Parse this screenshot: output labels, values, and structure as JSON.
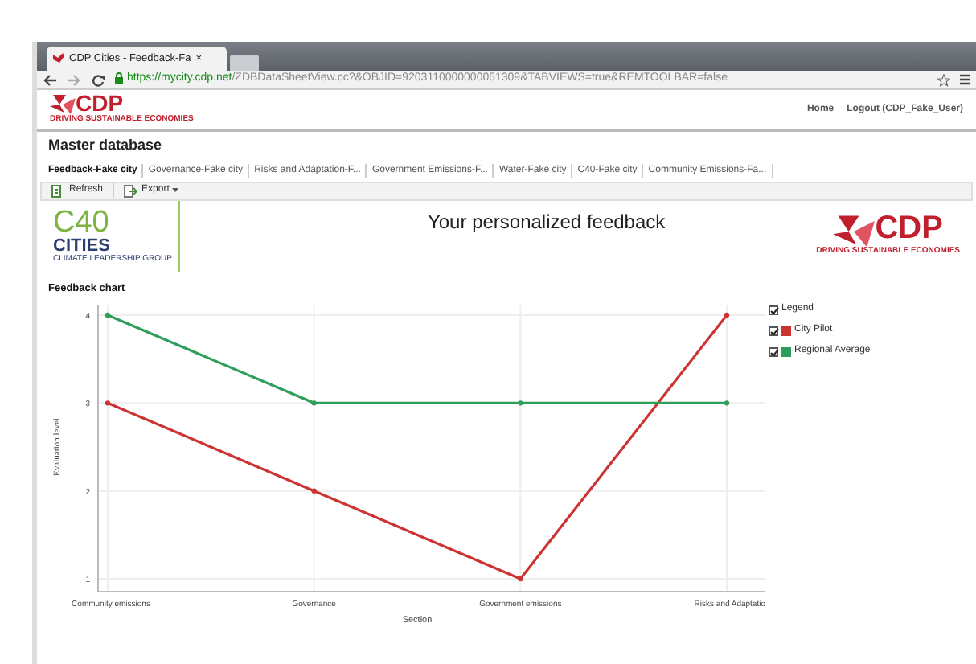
{
  "browser": {
    "tab_title": "CDP Cities - Feedback-Fa",
    "tab_close": "×",
    "url_host": "https://mycity.cdp.net",
    "url_path": "/ZDBDataSheetView.cc?&OBJID=9203110000000051309&TABVIEWS=true&REMTOOLBAR=false"
  },
  "header": {
    "logo": "CDP",
    "logo_tagline": "DRIVING SUSTAINABLE ECONOMIES",
    "links": [
      "Home",
      "Logout (CDP_Fake_User)"
    ]
  },
  "page_title": "Master database",
  "tabs": [
    {
      "label": "Feedback-Fake city",
      "selected": true
    },
    {
      "label": "Governance-Fake city",
      "selected": false
    },
    {
      "label": "Risks and Adaptation-F...",
      "selected": false
    },
    {
      "label": "Government Emissions-F...",
      "selected": false
    },
    {
      "label": "Water-Fake city",
      "selected": false
    },
    {
      "label": "C40-Fake city",
      "selected": false
    },
    {
      "label": "Community Emissions-Fa...",
      "selected": false
    }
  ],
  "toolbar": [
    {
      "label": "Refresh",
      "kind": "refresh"
    },
    {
      "label": "Export",
      "kind": "export"
    }
  ],
  "c40_logo": {
    "line1": "C40",
    "line2": "CITIES",
    "tagline": "CLIMATE LEADERSHIP GROUP"
  },
  "feedback_title": "Your personalized feedback",
  "cdp_logo": {
    "text": "CDP",
    "tagline": "DRIVING SUSTAINABLE ECONOMIES"
  },
  "chart_title": "Feedback chart",
  "chart_data": {
    "type": "line",
    "grid": true,
    "xlabel": "Section",
    "ylabel": "Evaluation level",
    "categories": [
      "Community emissions",
      "Governance",
      "Government emissions",
      "Risks and Adaptatio"
    ],
    "yticks": [
      1,
      2,
      3,
      4
    ],
    "ylim": [
      1,
      4
    ],
    "series": [
      {
        "name": "City Pilot",
        "color": "#cc3333",
        "marker": true,
        "values": [
          3,
          2,
          1,
          4
        ]
      },
      {
        "name": "Regional Average",
        "color": "#2e9e5b",
        "marker": true,
        "values": [
          4,
          3,
          3,
          3
        ]
      }
    ]
  },
  "legend": {
    "label": "Legend",
    "checked": true,
    "series_checked": [
      true,
      true
    ]
  }
}
